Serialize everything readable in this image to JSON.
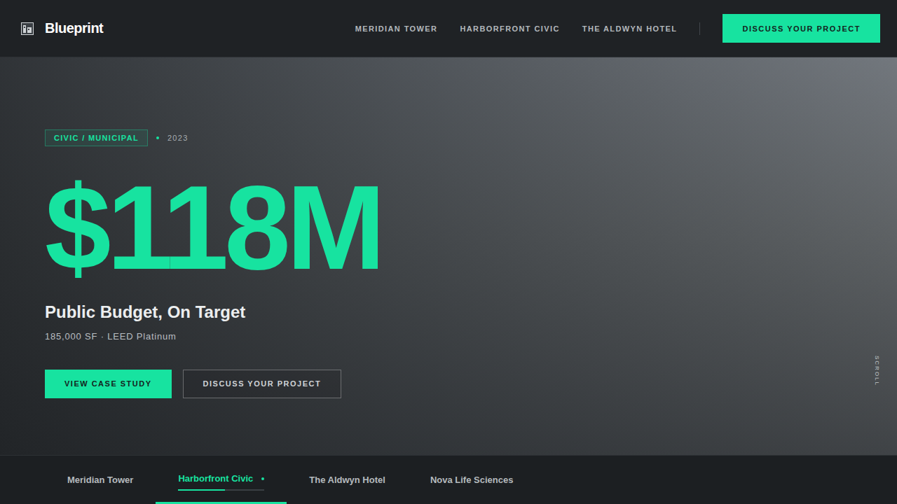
{
  "header": {
    "logo": "Blueprint",
    "nav": [
      "MERIDIAN TOWER",
      "HARBORFRONT CIVIC",
      "THE ALDWYN HOTEL"
    ],
    "cta": "DISCUSS YOUR PROJECT"
  },
  "hero": {
    "category": "CIVIC / MUNICIPAL",
    "year": "2023",
    "figure": "$118M",
    "headline": "Public Budget, On Target",
    "specs": "185,000 SF · LEED Platinum",
    "buttons": [
      {
        "label": "VIEW CASE STUDY",
        "kind": "primary"
      },
      {
        "label": "DISCUSS YOUR PROJECT",
        "kind": "outline"
      }
    ],
    "scroll": "SCROLL"
  },
  "projects": [
    {
      "label": "Meridian Tower",
      "selected": false
    },
    {
      "label": "Harborfront Civic",
      "selected": true,
      "level": 0.54
    },
    {
      "label": "The Aldwyn Hotel",
      "selected": false
    },
    {
      "label": "Nova Life Sciences",
      "selected": false
    }
  ]
}
